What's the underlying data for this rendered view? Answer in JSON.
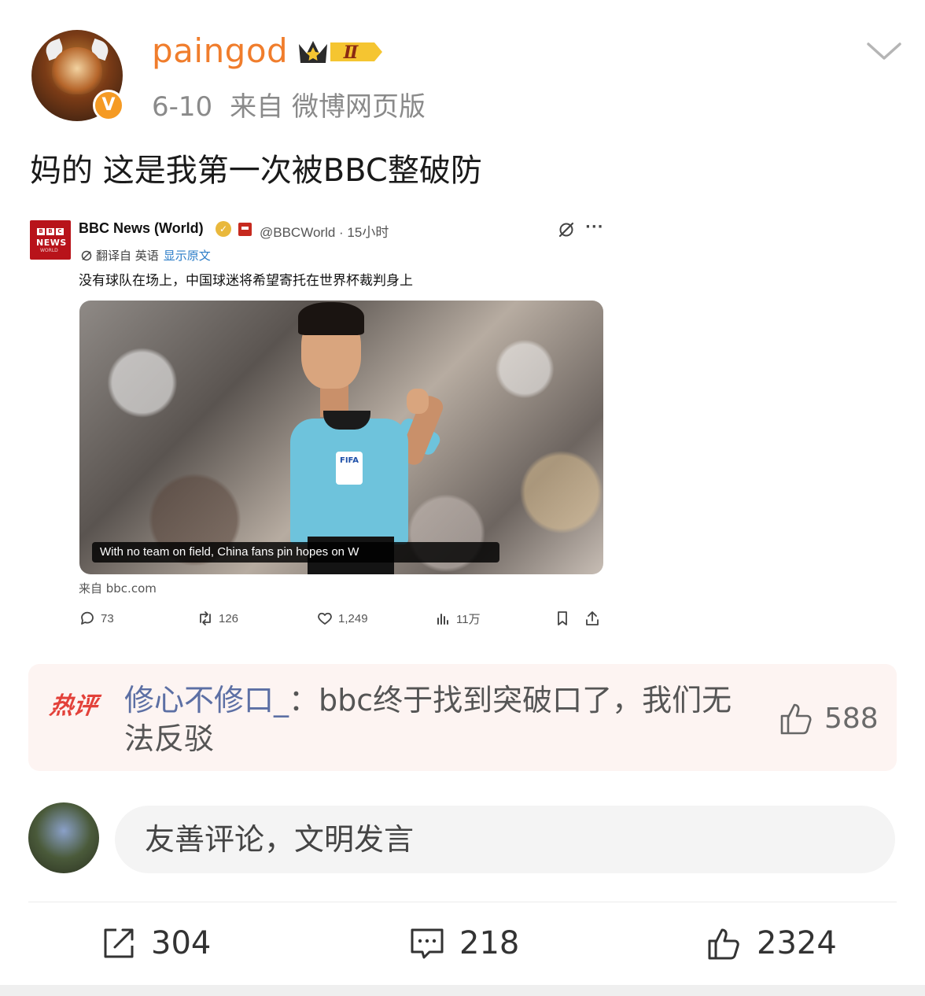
{
  "header": {
    "username": "paingod",
    "level_badge": "Ⅱ",
    "verified_mark": "V",
    "date": "6-10",
    "source": "来自 微博网页版"
  },
  "post": {
    "text": "妈的 这是我第一次被BBC整破防"
  },
  "embedded_tweet": {
    "logo_top": [
      "B",
      "B",
      "C"
    ],
    "logo_news": "NEWS",
    "logo_world": "WORLD",
    "account_name": "BBC News (World)",
    "handle_time": "@BBCWorld · 15小时",
    "translated_from": "翻译自 英语",
    "show_original": "显示原文",
    "body": "没有球队在场上，中国球迷将希望寄托在世界杯裁判身上",
    "media_caption": "With no team on field, China fans pin hopes on W",
    "badge_text": "FIFA",
    "from_site": "来自 bbc.com",
    "replies": "73",
    "retweets": "126",
    "likes": "1,249",
    "views": "11万"
  },
  "hot_comment": {
    "tag": "热评",
    "user": "修心不修口_",
    "separator": "：",
    "text": "bbc终于找到突破口了，我们无法反驳",
    "likes": "588"
  },
  "comment_input": {
    "placeholder": "友善评论，文明发言"
  },
  "stats": {
    "reposts": "304",
    "comments": "218",
    "likes": "2324"
  },
  "colors": {
    "username": "#f07d2c",
    "hot_tag": "#e3413a",
    "comment_user": "#5c6fa4",
    "link": "#2a7cc7"
  }
}
